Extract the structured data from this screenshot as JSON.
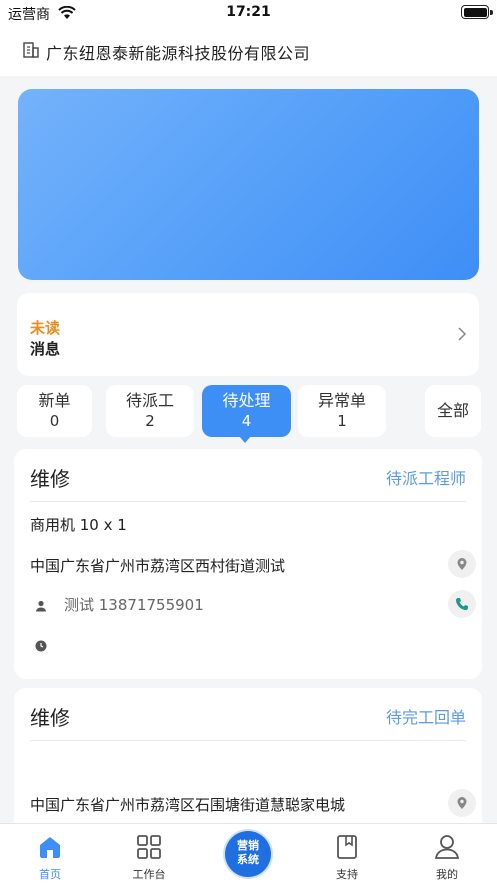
{
  "status_bar": {
    "carrier": "运营商",
    "time": "17:21"
  },
  "header": {
    "company_name": "广东纽恩泰新能源科技股份有限公司"
  },
  "message_card": {
    "unread_label": "未读",
    "title": "消息"
  },
  "order_tabs": [
    {
      "label": "新单",
      "count": "0"
    },
    {
      "label": "待派工",
      "count": "2"
    },
    {
      "label": "待处理",
      "count": "4"
    },
    {
      "label": "异常单",
      "count": "1"
    }
  ],
  "order_tabs_all": "全部",
  "orders": [
    {
      "type": "维修",
      "status": "待派工程师",
      "product": "商用机 10 x 1",
      "address": "中国广东省广州市荔湾区西村街道测试",
      "contact": "测试 13871755901"
    },
    {
      "type": "维修",
      "status": "待完工回单",
      "address": "中国广东省广州市荔湾区石围塘街道慧聪家电城"
    }
  ],
  "tabbar": {
    "home": "首页",
    "workbench": "工作台",
    "marketing": "营销\n系统",
    "support": "支持",
    "mine": "我的"
  },
  "colors": {
    "accent": "#3d8ef5",
    "unread": "#f08a1f",
    "status_link": "#5b9be8",
    "phone_icon": "#1a9a8a"
  }
}
